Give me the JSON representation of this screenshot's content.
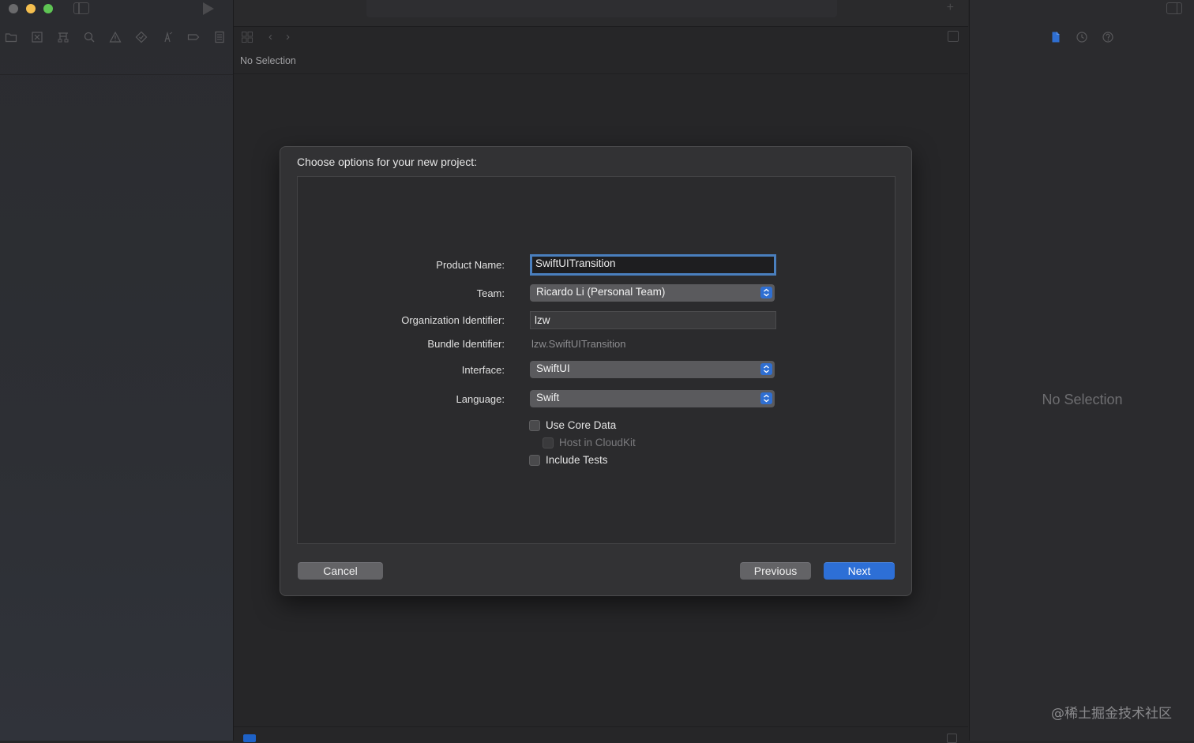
{
  "editor": {
    "no_selection": "No Selection"
  },
  "inspector": {
    "no_selection": "No Selection"
  },
  "dialog": {
    "title": "Choose options for your new project:",
    "fields": {
      "product_name_label": "Product Name:",
      "product_name_value": "SwiftUITransition",
      "team_label": "Team:",
      "team_value": "Ricardo Li (Personal Team)",
      "org_id_label": "Organization Identifier:",
      "org_id_value": "lzw",
      "bundle_id_label": "Bundle Identifier:",
      "bundle_id_value": "lzw.SwiftUITransition",
      "interface_label": "Interface:",
      "interface_value": "SwiftUI",
      "language_label": "Language:",
      "language_value": "Swift"
    },
    "options": {
      "use_core_data": "Use Core Data",
      "host_in_cloudkit": "Host in CloudKit",
      "include_tests": "Include Tests"
    },
    "buttons": {
      "cancel": "Cancel",
      "previous": "Previous",
      "next": "Next"
    }
  },
  "icons": {
    "navigator": [
      "folder-icon",
      "source-control-icon",
      "hierarchy-icon",
      "search-icon",
      "warning-icon",
      "test-icon",
      "debug-icon",
      "breakpoint-icon",
      "report-icon"
    ],
    "inspector": [
      "file-inspector-icon",
      "history-icon",
      "help-icon"
    ]
  },
  "colors": {
    "accent": "#2d6fd6",
    "focus_ring": "#4a7fbe"
  },
  "watermark": "@稀土掘金技术社区"
}
